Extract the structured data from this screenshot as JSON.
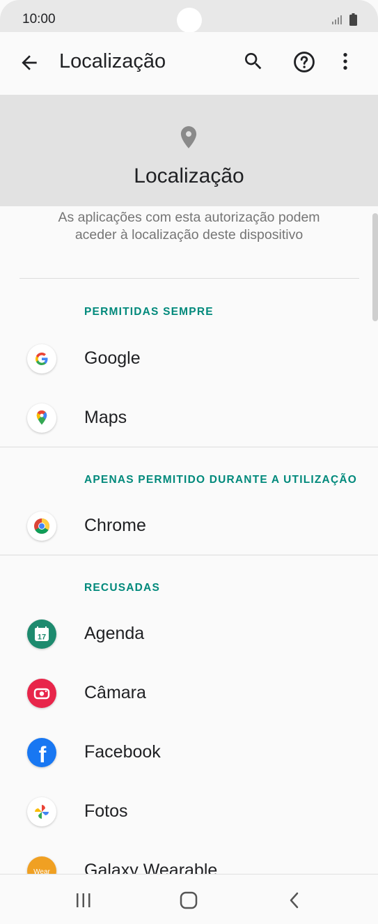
{
  "status_bar": {
    "time": "10:00"
  },
  "app_bar": {
    "title": "Localização"
  },
  "header": {
    "title": "Localização"
  },
  "description": "As aplicações com esta autorização podem aceder à localização deste dispositivo",
  "sections": [
    {
      "title": "PERMITIDAS SEMPRE",
      "apps": [
        {
          "name": "Google",
          "icon": "google-icon"
        },
        {
          "name": "Maps",
          "icon": "maps-icon"
        }
      ]
    },
    {
      "title": "APENAS PERMITIDO DURANTE A UTILIZAÇÃO",
      "apps": [
        {
          "name": "Chrome",
          "icon": "chrome-icon"
        }
      ]
    },
    {
      "title": "RECUSADAS",
      "apps": [
        {
          "name": "Agenda",
          "icon": "calendar-icon",
          "icon_text": "17"
        },
        {
          "name": "Câmara",
          "icon": "camera-icon"
        },
        {
          "name": "Facebook",
          "icon": "facebook-icon",
          "icon_text": "f"
        },
        {
          "name": "Fotos",
          "icon": "photos-icon"
        },
        {
          "name": "Galaxy Wearable",
          "icon": "wearable-icon",
          "icon_text": "Wear"
        }
      ]
    }
  ],
  "colors": {
    "section_title": "#00897b",
    "header_bg": "#e2e2e2"
  }
}
